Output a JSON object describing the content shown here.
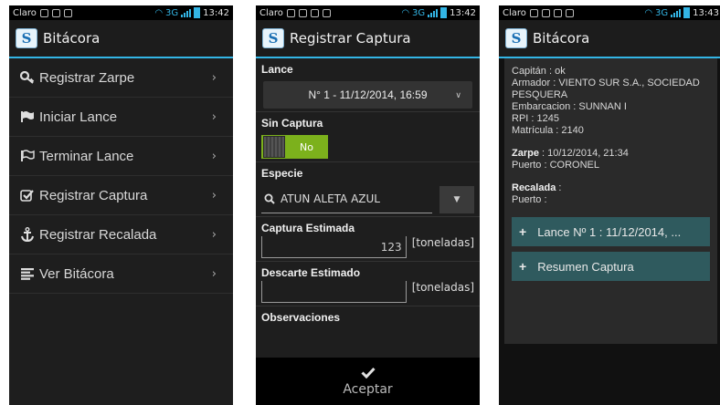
{
  "status": {
    "carrier": "Claro",
    "network": "3G",
    "time1": "13:42",
    "time2": "13:42",
    "time3": "13:43"
  },
  "app": {
    "title": "Bitácora",
    "logo_letter": "S"
  },
  "menu": {
    "items": [
      {
        "label": "Registrar Zarpe",
        "icon": "key-icon"
      },
      {
        "label": "Iniciar Lance",
        "icon": "flag-filled-icon"
      },
      {
        "label": "Terminar Lance",
        "icon": "flag-outline-icon"
      },
      {
        "label": "Registrar Captura",
        "icon": "checkbox-icon"
      },
      {
        "label": "Registrar Recalada",
        "icon": "anchor-icon"
      },
      {
        "label": "Ver Bitácora",
        "icon": "list-icon"
      }
    ],
    "chevron": "›"
  },
  "captura": {
    "title": "Registrar Captura",
    "lance_label": "Lance",
    "lance_value": "N° 1 - 11/12/2014, 16:59",
    "sin_captura_label": "Sin Captura",
    "toggle_value": "No",
    "especie_label": "Especie",
    "especie_value": "ATUN ALETA AZUL",
    "captura_label": "Captura Estimada",
    "captura_value": "123",
    "unit": "[toneladas]",
    "descarte_label": "Descarte Estimado",
    "descarte_value": "",
    "observaciones_label": "Observaciones",
    "accept_label": "Aceptar"
  },
  "bitacora": {
    "capitan": "Capitán : ok",
    "armador_1": "Armador : VIENTO SUR S.A., SOCIEDAD",
    "armador_2": "PESQUERA",
    "embarcacion": "Embarcacion : SUNNAN I",
    "rpi": "RPI : 1245",
    "matricula": "Matrícula : 2140",
    "zarpe_label": "Zarpe",
    "zarpe_value": " : 10/12/2014, 21:34",
    "zarpe_puerto": "Puerto : CORONEL",
    "recalada_label": "Recalada",
    "recalada_value": " :",
    "recalada_puerto": "Puerto :",
    "expanders": [
      "Lance Nº 1 : 11/12/2014, ...",
      "Resumen Captura"
    ]
  },
  "colors": {
    "accent": "#33b5e5",
    "toggle_on": "#7cb11c",
    "expander": "#2f5a5e"
  }
}
